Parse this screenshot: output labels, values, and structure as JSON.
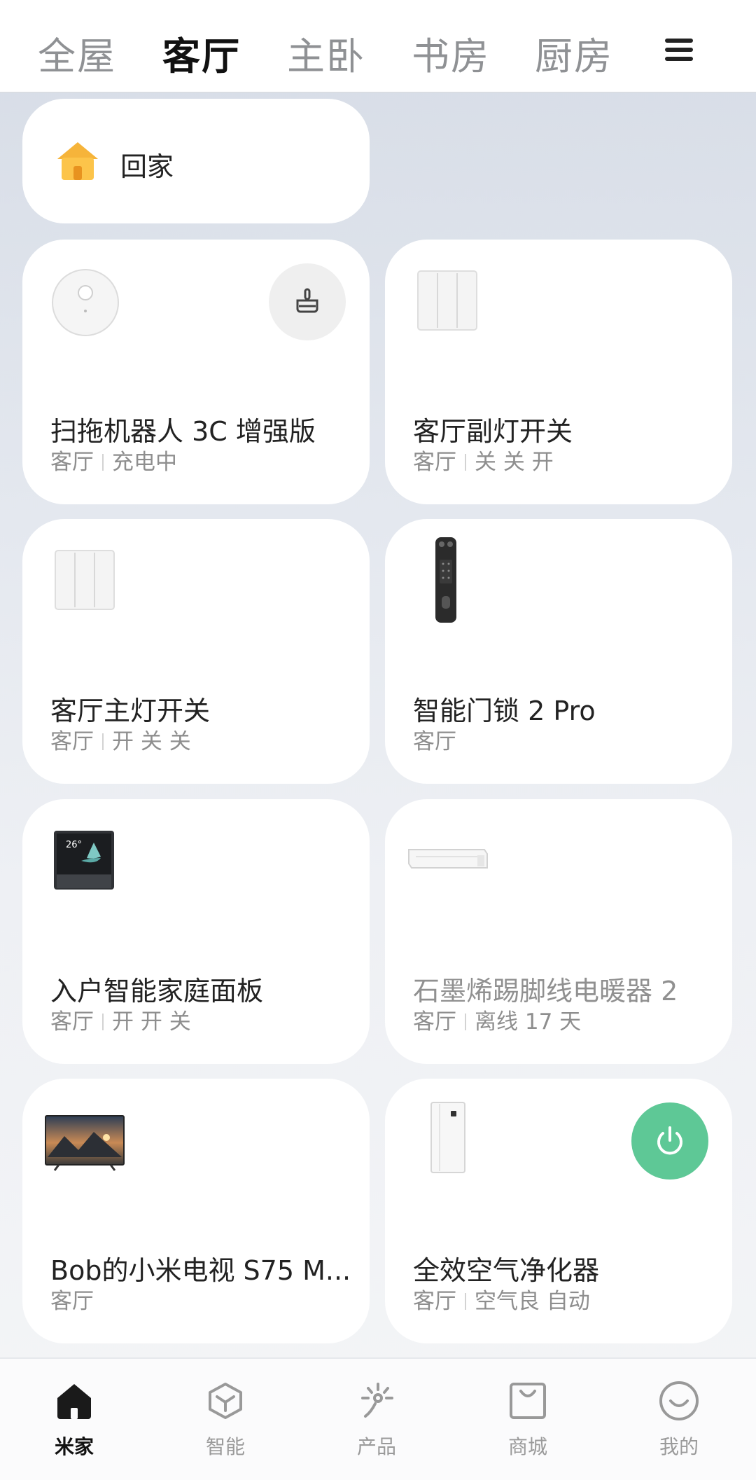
{
  "tabs": [
    "全屋",
    "客厅",
    "主卧",
    "书房",
    "厨房"
  ],
  "active_tab_index": 1,
  "scene": {
    "label": "回家"
  },
  "devices": [
    {
      "name": "扫拖机器人 3C 增强版",
      "room": "客厅",
      "state": "充电中",
      "thumb": "robot-vacuum-icon",
      "action": "broom-icon"
    },
    {
      "name": "客厅副灯开关",
      "room": "客厅",
      "state": "关 关 开",
      "thumb": "wall-switch-icon"
    },
    {
      "name": "客厅主灯开关",
      "room": "客厅",
      "state": "开 关 关",
      "thumb": "wall-switch-icon"
    },
    {
      "name": "智能门锁 2 Pro",
      "room": "客厅",
      "state": "",
      "thumb": "door-lock-icon"
    },
    {
      "name": "入户智能家庭面板",
      "room": "客厅",
      "state": "开 开 关",
      "thumb": "home-panel-icon",
      "panel_temp": "26°"
    },
    {
      "name": "石墨烯踢脚线电暖器 2",
      "room": "客厅",
      "state": "离线 17 天",
      "thumb": "baseboard-heater-icon",
      "offline": true
    },
    {
      "name": "Bob的小米电视 S75 M...",
      "room": "客厅",
      "state": "",
      "thumb": "tv-icon"
    },
    {
      "name": "全效空气净化器",
      "room": "客厅",
      "state": "空气良 自动",
      "thumb": "air-purifier-icon",
      "action": "power-icon",
      "action_color": "#5ec896"
    }
  ],
  "bottom_nav": [
    {
      "label": "米家",
      "icon": "home-icon",
      "active": true
    },
    {
      "label": "智能",
      "icon": "smart-cube-icon",
      "active": false
    },
    {
      "label": "产品",
      "icon": "product-sparkle-icon",
      "active": false
    },
    {
      "label": "商城",
      "icon": "shopping-bag-icon",
      "active": false
    },
    {
      "label": "我的",
      "icon": "smile-icon",
      "active": false
    }
  ],
  "colors": {
    "accent_green": "#5ec896",
    "scene_icon": "#f7b733"
  }
}
